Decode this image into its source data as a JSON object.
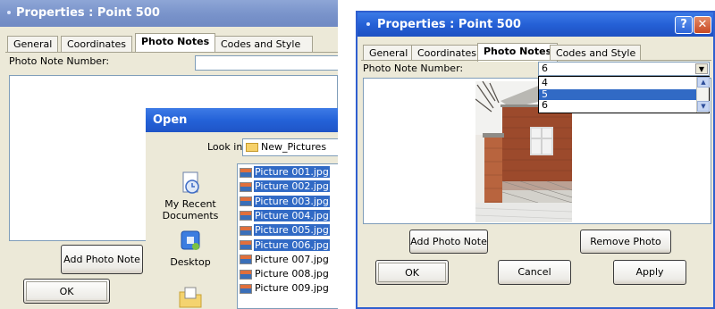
{
  "left_window": {
    "title": "Properties : Point 500",
    "tabs": [
      "General",
      "Coordinates",
      "Photo Notes",
      "Codes and Style"
    ],
    "photo_note_label": "Photo Note Number:",
    "add_button": "Add Photo Note",
    "ok_button": "OK"
  },
  "open_dialog": {
    "title": "Open",
    "look_in_label": "Look in:",
    "look_in_value": "New_Pictures",
    "places": [
      {
        "label": "My Recent Documents",
        "icon": "recent-documents-icon"
      },
      {
        "label": "Desktop",
        "icon": "desktop-icon"
      },
      {
        "label": "",
        "icon": "my-documents-icon"
      }
    ],
    "files": [
      {
        "name": "Picture 001.jpg",
        "selected": true
      },
      {
        "name": "Picture 002.jpg",
        "selected": true
      },
      {
        "name": "Picture 003.jpg",
        "selected": true
      },
      {
        "name": "Picture 004.jpg",
        "selected": true
      },
      {
        "name": "Picture 005.jpg",
        "selected": true
      },
      {
        "name": "Picture 006.jpg",
        "selected": true
      },
      {
        "name": "Picture 007.jpg",
        "selected": false
      },
      {
        "name": "Picture 008.jpg",
        "selected": false
      },
      {
        "name": "Picture 009.jpg",
        "selected": false
      }
    ]
  },
  "right_window": {
    "title": "Properties : Point 500",
    "tabs": [
      "General",
      "Coordinates",
      "Photo Notes",
      "Codes and Style"
    ],
    "photo_note_label": "Photo Note Number:",
    "photo_note_value": "6",
    "dropdown_options": [
      "4",
      "5",
      "6"
    ],
    "dropdown_selected": "5",
    "add_button": "Add Photo Note",
    "remove_button": "Remove Photo Note",
    "ok_button": "OK",
    "cancel_button": "Cancel",
    "apply_button": "Apply",
    "help_glyph": "?",
    "close_glyph": "✕"
  },
  "colors": {
    "xp_blue_title": "#2560d6",
    "inactive_title": "#7a94cb",
    "selection": "#316ac5",
    "dialog_face": "#ece9d8"
  }
}
